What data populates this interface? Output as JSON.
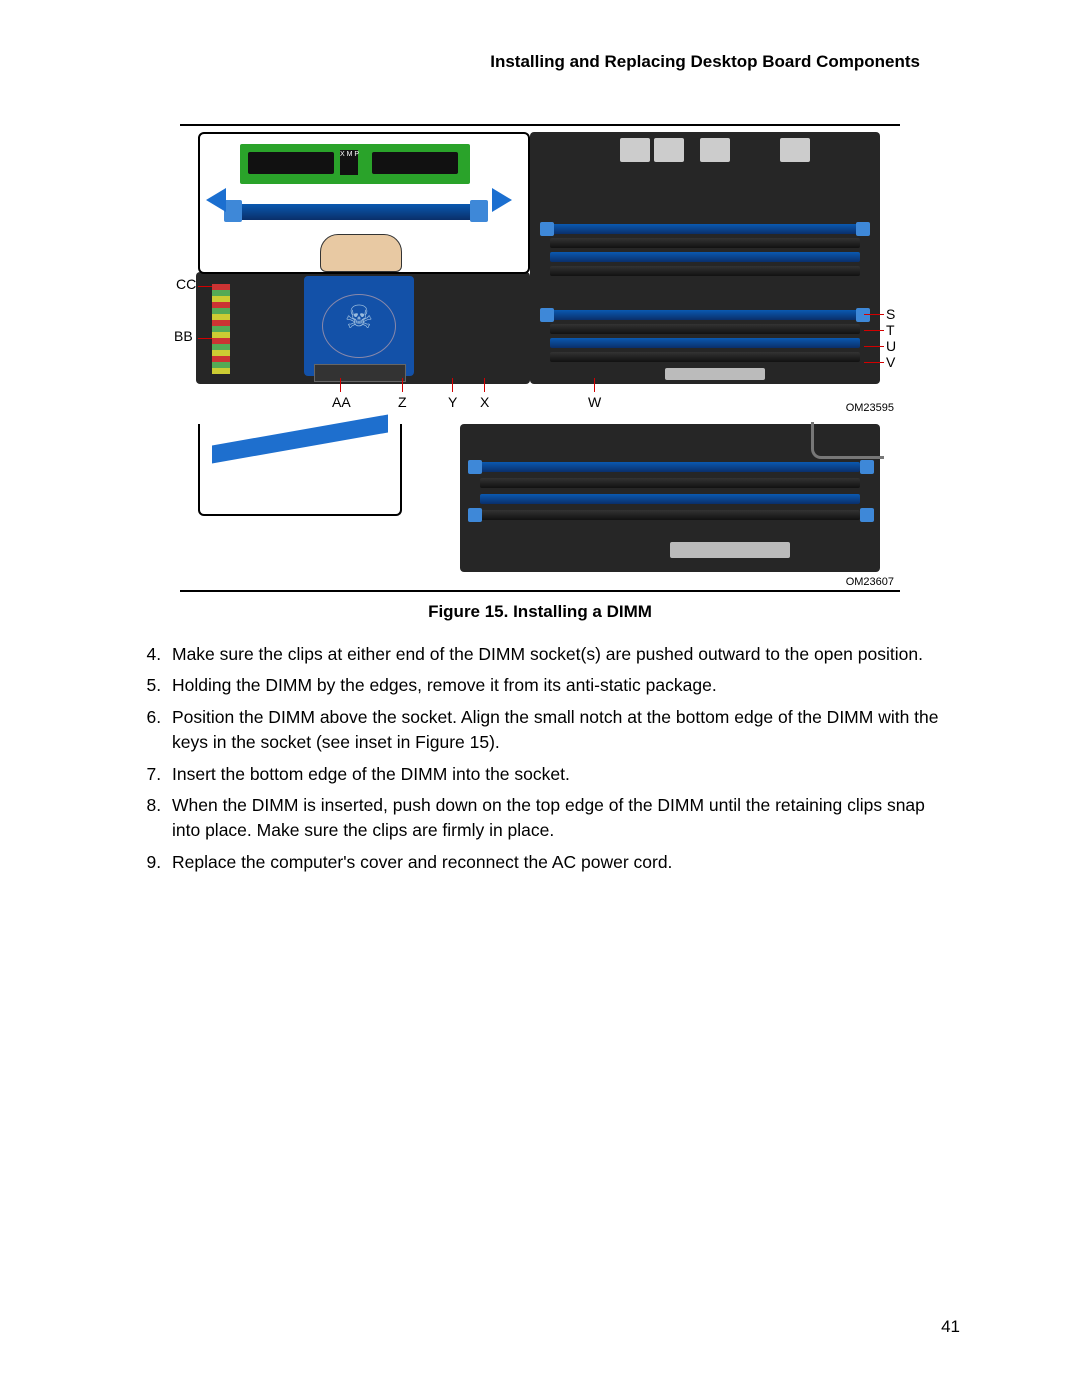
{
  "header": {
    "title": "Installing and Replacing Desktop Board Components"
  },
  "figure": {
    "caption": "Figure 15.  Installing a DIMM",
    "panel1": {
      "om": "OM23595",
      "labels_left": {
        "CC": "CC",
        "BB": "BB"
      },
      "labels_bottom": {
        "AA": "AA",
        "Z": "Z",
        "Y": "Y",
        "X": "X",
        "W": "W"
      },
      "labels_right": {
        "S": "S",
        "T": "T",
        "U": "U",
        "V": "V"
      },
      "inset_chip_label": "X M P"
    },
    "panel2": {
      "om": "OM23607"
    }
  },
  "steps": {
    "start": 4,
    "items": [
      "Make sure the clips at either end of the DIMM socket(s) are pushed outward to the open position.",
      "Holding the DIMM by the edges, remove it from its anti-static package.",
      "Position the DIMM above the socket.  Align the small notch at the bottom edge of the DIMM with the keys in the socket (see inset in Figure 15).",
      "Insert the bottom edge of the DIMM into the socket.",
      "When the DIMM is inserted, push down on the top edge of the DIMM until the retaining clips snap into place.  Make sure the clips are firmly in place.",
      "Replace the computer's cover and reconnect the AC power cord."
    ]
  },
  "page_number": "41"
}
